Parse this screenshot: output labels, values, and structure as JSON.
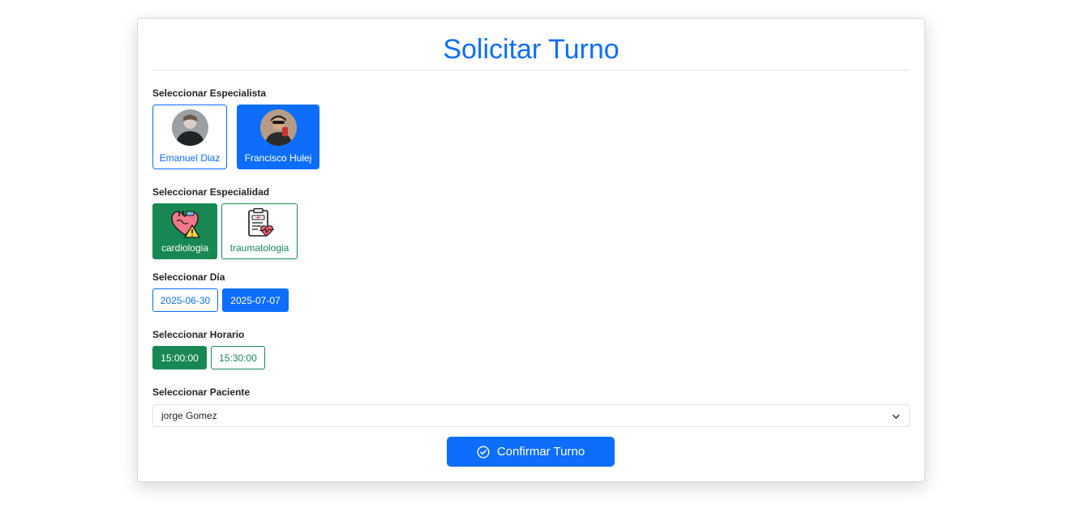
{
  "form": {
    "title": "Solicitar Turno",
    "especialista_label": "Seleccionar Especialista",
    "especialidad_label": "Seleccionar Especialidad",
    "dia_label": "Seleccionar Día",
    "horario_label": "Seleccionar Horario",
    "paciente_label": "Seleccionar Paciente"
  },
  "especialistas": [
    {
      "name": "Emanuel Diaz",
      "selected": false,
      "avatar_icon": "person-photo-icon"
    },
    {
      "name": "Francisco Hulej",
      "selected": true,
      "avatar_icon": "person-photo-icon"
    }
  ],
  "especialidades": [
    {
      "name": "cardiologia",
      "selected": true,
      "icon": "heart-warning-icon"
    },
    {
      "name": "traumatologia",
      "selected": false,
      "icon": "clipboard-heartbeat-icon"
    }
  ],
  "dias": [
    {
      "value": "2025-06-30",
      "selected": false
    },
    {
      "value": "2025-07-07",
      "selected": true
    }
  ],
  "horarios": [
    {
      "value": "15:00:00",
      "selected": true
    },
    {
      "value": "15:30:00",
      "selected": false
    }
  ],
  "paciente": {
    "selected": "jorge Gomez"
  },
  "actions": {
    "confirm_label": "Confirmar Turno",
    "confirm_icon": "check-circle-icon"
  },
  "colors": {
    "primary": "#0d6efd",
    "success": "#198754",
    "border": "#dee2e6"
  }
}
